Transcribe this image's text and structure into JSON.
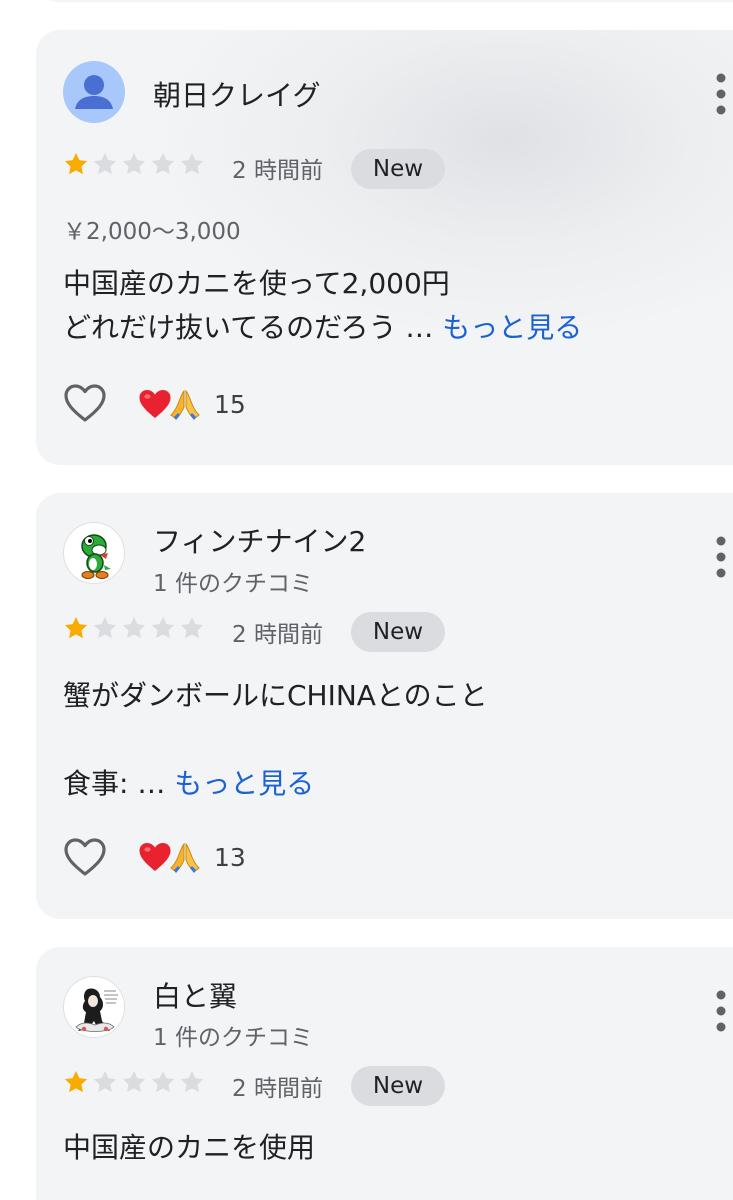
{
  "reviews": [
    {
      "author": "朝日クレイグ",
      "avatar_icon": "default-person-avatar",
      "rating": 1,
      "max_rating": 5,
      "time": "2 時間前",
      "badge": "New",
      "price": "￥2,000〜3,000",
      "text_line1": "中国産のカニを使って2,000円",
      "text_line2": "どれだけ抜いてるのだろう … ",
      "more": "もっと見る",
      "reaction_count": "15"
    },
    {
      "author": "フィンチナイン2",
      "avatar_icon": "yoshi-avatar",
      "review_count": "1 件のクチコミ",
      "rating": 1,
      "max_rating": 5,
      "time": "2 時間前",
      "badge": "New",
      "text_line1": "蟹がダンボールにCHINAとのこと",
      "text_line2": "食事: … ",
      "more": "もっと見る",
      "reaction_count": "13"
    },
    {
      "author": "白と翼",
      "avatar_icon": "illustration-avatar",
      "review_count": "1 件のクチコミ",
      "rating": 1,
      "max_rating": 5,
      "time": "2 時間前",
      "badge": "New",
      "text_line1": "中国産のカニを使用"
    }
  ],
  "colors": {
    "star_filled": "#f9ab00",
    "star_empty": "#dadce0",
    "link": "#1a62d2",
    "card_bg": "#f3f4f6"
  }
}
